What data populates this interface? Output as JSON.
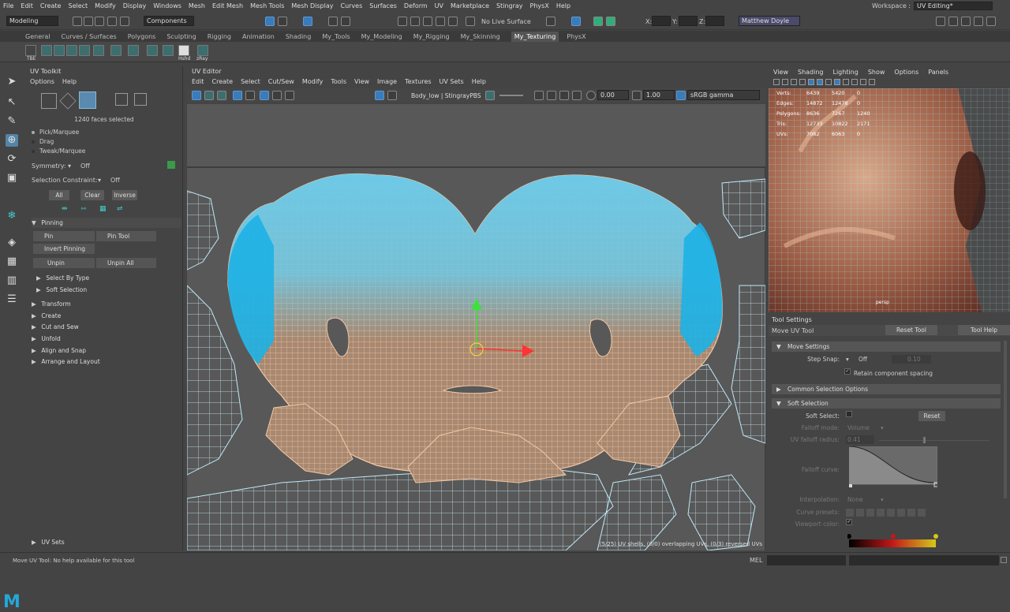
{
  "menubar": [
    "File",
    "Edit",
    "Create",
    "Select",
    "Modify",
    "Display",
    "Windows",
    "Mesh",
    "Edit Mesh",
    "Mesh Tools",
    "Mesh Display",
    "Curves",
    "Surfaces",
    "Deform",
    "UV",
    "Marketplace",
    "Stingray",
    "PhysX",
    "Help"
  ],
  "workspace": {
    "label": "Workspace :",
    "value": "UV Editing*"
  },
  "statusline": {
    "mode": "Modeling",
    "components": "Components",
    "live_surface": "No Live Surface",
    "x": "X:",
    "y": "Y:",
    "z": "Z:",
    "user": "Matthew Doyle"
  },
  "shelf_tabs": [
    "General",
    "Curves / Surfaces",
    "Polygons",
    "Sculpting",
    "Rigging",
    "Animation",
    "Shading",
    "My_Tools",
    "My_Modeling",
    "My_Rigging",
    "My_Skinning",
    "My_Texturing",
    "PhysX"
  ],
  "shelf_labels": [
    "TBE",
    "Hshd",
    "zRay"
  ],
  "uv_toolkit": {
    "title": "UV Toolkit",
    "menu": [
      "Options",
      "Help"
    ],
    "faces_selected": "1240 faces selected",
    "modes": [
      "Pick/Marquee",
      "Drag",
      "Tweak/Marquee"
    ],
    "symmetry_label": "Symmetry:",
    "symmetry_value": "Off",
    "constraint_label": "Selection Constraint:",
    "constraint_value": "Off",
    "buttons": [
      "All",
      "Clear",
      "Inverse"
    ],
    "pinning": {
      "title": "Pinning",
      "pin": "Pin",
      "pin_tool": "Pin Tool",
      "invert": "Invert Pinning",
      "unpin": "Unpin",
      "unpin_all": "Unpin All"
    },
    "sub_sections": [
      "Select By Type",
      "Soft Selection"
    ],
    "sections": [
      "Transform",
      "Create",
      "Cut and Sew",
      "Unfold",
      "Align and Snap",
      "Arrange and Layout"
    ],
    "uv_sets": "UV Sets"
  },
  "uv_editor": {
    "title": "UV Editor",
    "menu": [
      "Edit",
      "Create",
      "Select",
      "Cut/Sew",
      "Modify",
      "Tools",
      "View",
      "Image",
      "Textures",
      "UV Sets",
      "Help"
    ],
    "shader": "Body_low | StingrayPBS",
    "value_a": "0.00",
    "value_b": "1.00",
    "colorspace": "sRGB gamma",
    "viewport_msg": "(5/25) UV shells, (0/0) overlapping UVs, (0/3) reversed UVs"
  },
  "persp": {
    "menu": [
      "View",
      "Shading",
      "Lighting",
      "Show",
      "Options",
      "Panels"
    ],
    "hud": [
      {
        "label": "Verts:",
        "a": "6439",
        "b": "5420",
        "c": "0"
      },
      {
        "label": "Edges:",
        "a": "14872",
        "b": "12478",
        "c": "0"
      },
      {
        "label": "Polygons:",
        "a": "8636",
        "b": "7267",
        "c": "1240"
      },
      {
        "label": "Tris:",
        "a": "12733",
        "b": "10822",
        "c": "2171"
      },
      {
        "label": "UVs:",
        "a": "7082",
        "b": "6063",
        "c": "0"
      }
    ],
    "camera": "persp"
  },
  "tool_settings": {
    "title": "Tool Settings",
    "tool": "Move UV Tool",
    "reset_tool": "Reset Tool",
    "tool_help": "Tool Help",
    "move_settings": "Move Settings",
    "step_snap_label": "Step Snap:",
    "step_snap_value": "Off",
    "step_snap_num": "0.10",
    "retain": "Retain component spacing",
    "common": "Common Selection Options",
    "soft_selection": "Soft Selection",
    "soft_select_label": "Soft Select:",
    "reset": "Reset",
    "falloff_mode_label": "Falloff mode:",
    "falloff_mode_value": "Volume",
    "uv_falloff_label": "UV falloff radius:",
    "uv_falloff_value": "0.41",
    "falloff_curve_label": "Falloff curve:",
    "interpolation_label": "Interpolation:",
    "interpolation_value": "None",
    "curve_presets_label": "Curve presets:",
    "viewport_color_label": "Viewport color:"
  },
  "bottom": {
    "help": "Move UV Tool: No help available for this tool",
    "mel": "MEL"
  },
  "colors": {
    "uv_wire": "#f3c7a4",
    "uv_fill": "#6ec9e6",
    "selection": "#1db1e6"
  }
}
